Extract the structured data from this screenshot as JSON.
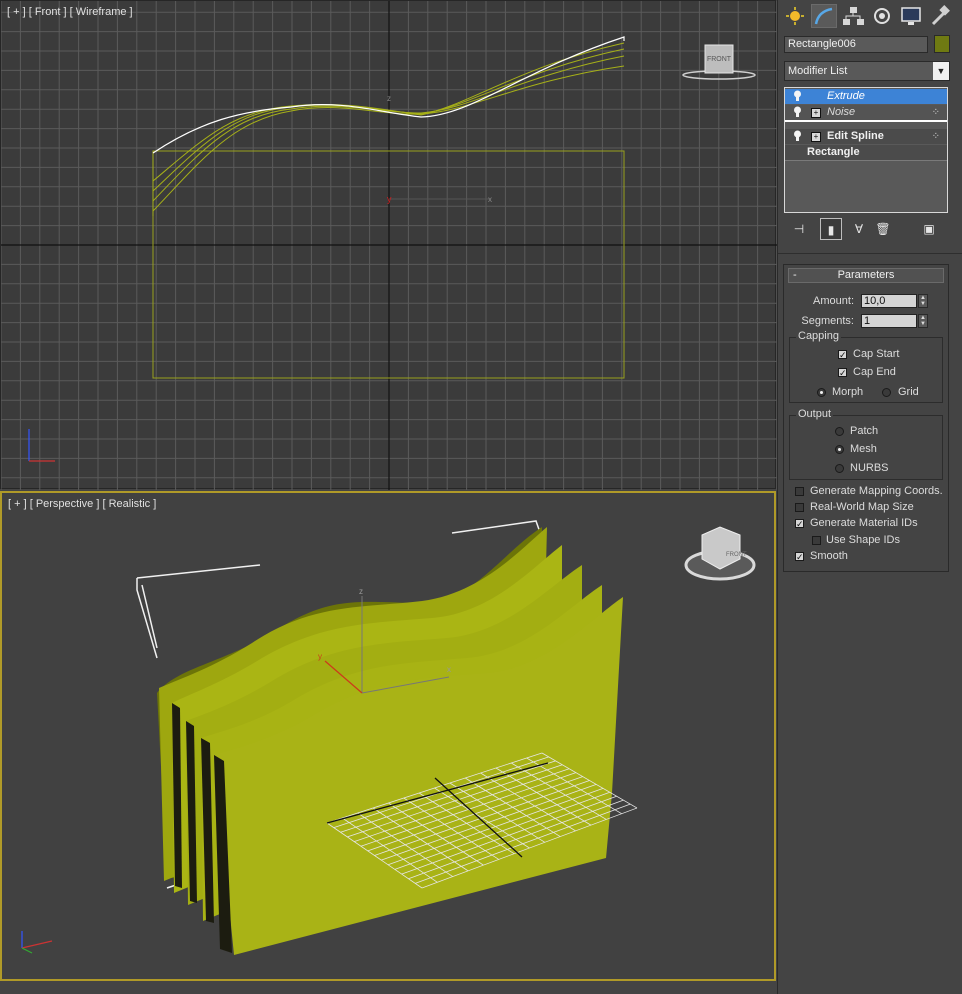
{
  "viewports": {
    "front": {
      "label": "[ + ] [ Front ] [ Wireframe ]",
      "viewcube_label": "FRONT"
    },
    "perspective": {
      "label": "[ + ] [ Perspective ] [ Realistic ]",
      "viewcube_label": "FRONT"
    }
  },
  "command_panel": {
    "tabs": [
      "create-icon",
      "modify-icon",
      "hierarchy-icon",
      "motion-icon",
      "display-icon",
      "utilities-icon"
    ],
    "object_name": "Rectangle006",
    "object_color": "#6f7a12",
    "modifier_list_label": "Modifier List",
    "stack": [
      {
        "label": "Extrude",
        "selected": true
      },
      {
        "label": "Noise"
      },
      {
        "label": "Edit Spline"
      },
      {
        "label": "Rectangle"
      }
    ],
    "parameters": {
      "title": "Parameters",
      "amount_label": "Amount:",
      "amount_value": "10,0",
      "segments_label": "Segments:",
      "segments_value": "1",
      "capping_title": "Capping",
      "cap_start": "Cap Start",
      "cap_end": "Cap End",
      "morph": "Morph",
      "grid": "Grid",
      "output_title": "Output",
      "patch": "Patch",
      "mesh": "Mesh",
      "nurbs": "NURBS",
      "gen_mapping": "Generate Mapping Coords.",
      "real_world": "Real-World Map Size",
      "gen_material": "Generate Material IDs",
      "use_shape": "Use Shape IDs",
      "smooth": "Smooth"
    }
  },
  "colors": {
    "selection_yellow": "#a6b018",
    "active_border": "#b09a28",
    "stack_highlight": "#3d83d6"
  }
}
